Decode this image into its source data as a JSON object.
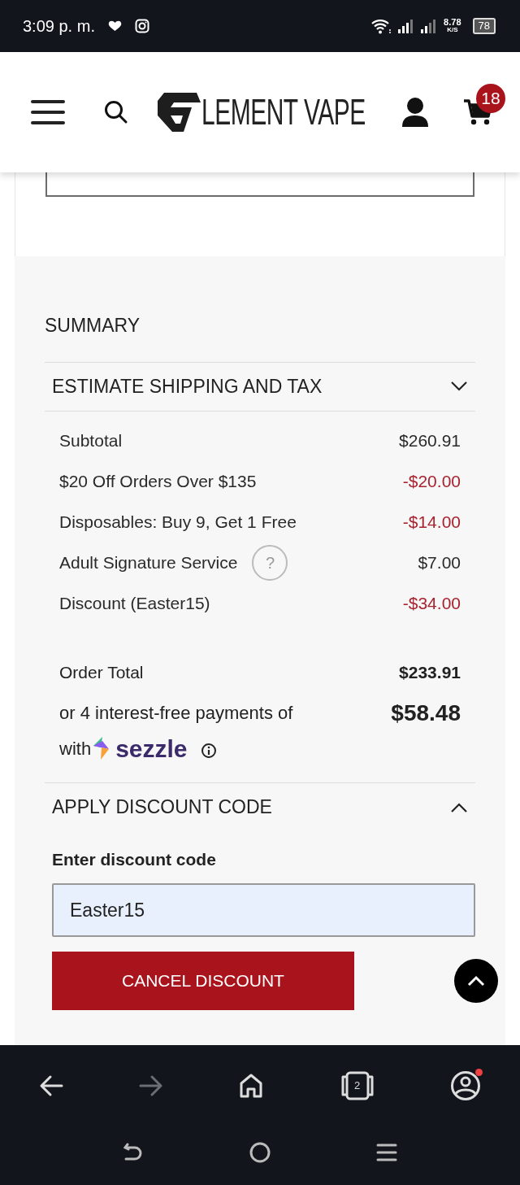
{
  "status_bar": {
    "time": "3:09 p. m.",
    "network_speed": "8.78",
    "speed_unit": "K/S",
    "battery": "78"
  },
  "header": {
    "logo_text": "LEMENT VAPE",
    "cart_count": "18"
  },
  "summary": {
    "title": "SUMMARY",
    "shipping": {
      "title": "ESTIMATE SHIPPING AND TAX",
      "expanded": false
    },
    "lines": [
      {
        "label": "Subtotal",
        "amount": "$260.91",
        "kind": "charge",
        "help": false
      },
      {
        "label": "$20 Off Orders Over $135",
        "amount": "-$20.00",
        "kind": "discount",
        "help": false
      },
      {
        "label": "Disposables: Buy 9, Get 1 Free",
        "amount": "-$14.00",
        "kind": "discount",
        "help": false
      },
      {
        "label": "Adult Signature Service",
        "amount": "$7.00",
        "kind": "charge",
        "help": true,
        "help_mark": "?"
      },
      {
        "label": "Discount (Easter15)",
        "amount": "-$34.00",
        "kind": "discount",
        "help": false
      }
    ],
    "total": {
      "label": "Order Total",
      "amount": "$233.91"
    },
    "installments": {
      "text": "or 4 interest-free payments of",
      "amount": "$58.48",
      "with": "with",
      "provider": "sezzle"
    },
    "discount_code": {
      "title": "APPLY DISCOUNT CODE",
      "expanded": true,
      "label": "Enter discount code",
      "value": "Easter15",
      "button": "CANCEL DISCOUNT"
    }
  },
  "browser_bar": {
    "tab_count": "2",
    "forward_disabled": true,
    "account_notification": true
  }
}
